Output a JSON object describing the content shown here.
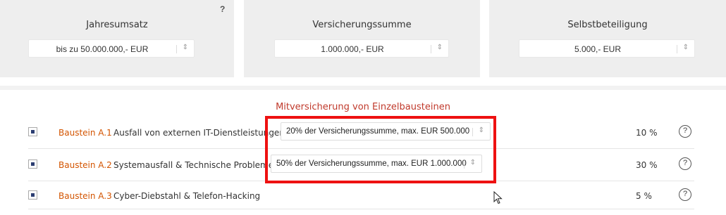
{
  "filters": {
    "help_label": "?",
    "umsatz": {
      "label": "Jahresumsatz",
      "value": "bis zu 50.000.000,- EUR"
    },
    "summe": {
      "label": "Versicherungssumme",
      "value": "1.000.000,- EUR"
    },
    "selbst": {
      "label": "Selbstbeteiligung",
      "value": "5.000,- EUR"
    },
    "arrow": "⇕"
  },
  "section": {
    "title": "Mitversicherung von Einzelbausteinen"
  },
  "rows": [
    {
      "code": "Baustein A.1",
      "description": "Ausfall von externen IT-Dienstleistungen",
      "select": "20% der Versicherungssumme, max. EUR 500.000",
      "percent": "10 %",
      "help": "?"
    },
    {
      "code": "Baustein A.2",
      "description": "Systemausfall & Technische Probleme",
      "select": "50% der Versicherungssumme, max. EUR 1.000.000",
      "percent": "30 %",
      "help": "?"
    },
    {
      "code": "Baustein A.3",
      "description": "Cyber-Diebstahl & Telefon-Hacking",
      "percent": "5 %",
      "help": "?"
    }
  ],
  "colors": {
    "highlight": "#ee1111",
    "accent": "#d35400",
    "title": "#c0392b"
  }
}
